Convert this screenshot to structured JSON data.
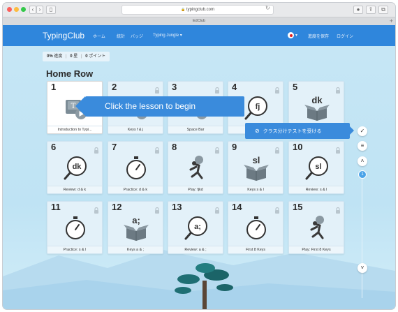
{
  "browser": {
    "url": "typingclub.com",
    "tab_title": "EdClub"
  },
  "nav": {
    "brand": "TypingClub",
    "links": [
      "ホーム",
      "統計",
      "バッジ",
      "Typing Jungle ▾"
    ],
    "right_links": [
      "進度を保存",
      "ログイン"
    ]
  },
  "stats": {
    "progress_value": "0%",
    "progress_label": "進度",
    "stars_value": "0",
    "stars_label": "星",
    "points_value": "0",
    "points_label": "ポイント"
  },
  "section": {
    "title": "Home Row"
  },
  "callout": {
    "text": "Click the lesson to begin"
  },
  "placement": {
    "text": "クラス分けテストを受ける"
  },
  "side": {
    "page": "1"
  },
  "lessons": [
    {
      "num": "1",
      "label": "Introduction to Typi...",
      "icon": "keyboard-key-icon",
      "locked": false
    },
    {
      "num": "2",
      "label": "Keys f & j",
      "icon": "keyboard-key-icon",
      "locked": true
    },
    {
      "num": "3",
      "label": "Space Bar",
      "icon": "keyboard-key-icon",
      "locked": true
    },
    {
      "num": "4",
      "label": "",
      "icon": "magnifier-icon",
      "text": "fj",
      "locked": true
    },
    {
      "num": "5",
      "label": "",
      "icon": "box-icon",
      "text": "dk",
      "locked": true
    },
    {
      "num": "6",
      "label": "Review: d & k",
      "icon": "magnifier-icon",
      "text": "dk",
      "locked": true
    },
    {
      "num": "7",
      "label": "Practice: d & k",
      "icon": "stopwatch-icon",
      "locked": true
    },
    {
      "num": "8",
      "label": "Play: fjkd",
      "icon": "runner-icon",
      "locked": true
    },
    {
      "num": "9",
      "label": "Keys s & l",
      "icon": "box-icon",
      "text": "sl",
      "locked": true
    },
    {
      "num": "10",
      "label": "Review: s & l",
      "icon": "magnifier-icon",
      "text": "sl",
      "locked": true
    },
    {
      "num": "11",
      "label": "Practice: s & l",
      "icon": "stopwatch-icon",
      "locked": true
    },
    {
      "num": "12",
      "label": "Keys a & ;",
      "icon": "box-icon",
      "text": "a;",
      "locked": true
    },
    {
      "num": "13",
      "label": "Review: a & ;",
      "icon": "magnifier-icon",
      "text": "a;",
      "locked": true
    },
    {
      "num": "14",
      "label": "First 8 Keys",
      "icon": "stopwatch-icon",
      "locked": true
    },
    {
      "num": "15",
      "label": "Play: First 8 Keys",
      "icon": "runner-icon",
      "locked": true
    }
  ]
}
